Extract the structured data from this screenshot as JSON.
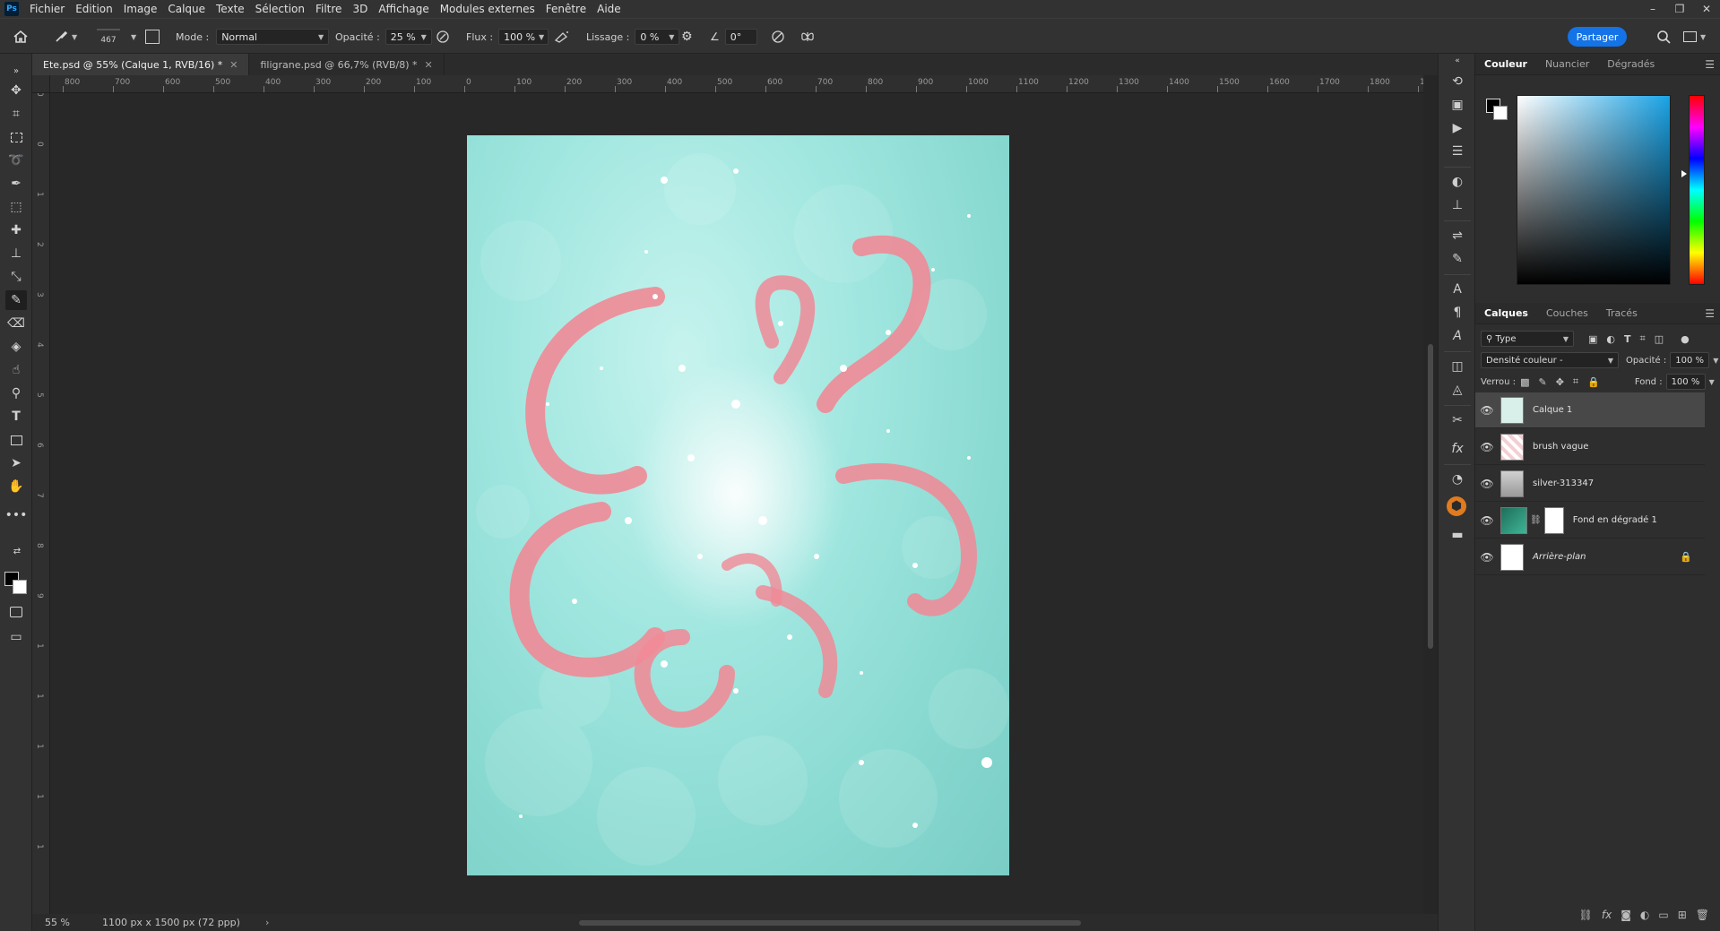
{
  "menu": {
    "logo": "Ps",
    "items": [
      "Fichier",
      "Edition",
      "Image",
      "Calque",
      "Texte",
      "Sélection",
      "Filtre",
      "3D",
      "Affichage",
      "Modules externes",
      "Fenêtre",
      "Aide"
    ]
  },
  "window_controls": {
    "minimize": "–",
    "restore": "❐",
    "close": "✕"
  },
  "options": {
    "brush_size": "467",
    "mode_label": "Mode :",
    "mode_value": "Normal",
    "opacity_label": "Opacité :",
    "opacity_value": "25 %",
    "flow_label": "Flux :",
    "flow_value": "100 %",
    "smoothing_label": "Lissage :",
    "smoothing_value": "0 %",
    "angle_value": "0°",
    "share_label": "Partager"
  },
  "tabs": [
    {
      "label": "Ete.psd @ 55% (Calque 1, RVB/16) *",
      "active": true
    },
    {
      "label": "filigrane.psd @ 66,7% (RVB/8) *",
      "active": false
    }
  ],
  "ruler_h_labels": [
    "800",
    "700",
    "600",
    "500",
    "400",
    "300",
    "200",
    "100",
    "0",
    "100",
    "200",
    "300",
    "400",
    "500",
    "600",
    "700",
    "800",
    "900",
    "1000",
    "1100",
    "1200",
    "1300",
    "1400",
    "1500",
    "1600",
    "1700",
    "1800",
    "1900"
  ],
  "ruler_v_labels": [
    "0",
    "0",
    "1",
    "2",
    "3",
    "4",
    "5",
    "6",
    "7",
    "8",
    "9",
    "1",
    "1",
    "1",
    "1",
    "1"
  ],
  "status": {
    "zoom": "55 %",
    "doc_size": "1100 px x 1500 px (72 ppp)",
    "arrow": "›"
  },
  "color_panel": {
    "tabs": [
      "Couleur",
      "Nuancier",
      "Dégradés"
    ],
    "active_tab": "Couleur",
    "foreground": "#000000",
    "background": "#ffffff"
  },
  "layers_panel": {
    "tabs": [
      "Calques",
      "Couches",
      "Tracés"
    ],
    "active_tab": "Calques",
    "filter_value": "Type",
    "blend_mode": "Densité couleur -",
    "opacity_label": "Opacité :",
    "opacity_value": "100 %",
    "lock_label": "Verrou :",
    "fill_label": "Fond :",
    "fill_value": "100 %",
    "layers": [
      {
        "name": "Calque 1",
        "selected": true,
        "thumb": "#d9efe9"
      },
      {
        "name": "brush vague",
        "selected": false,
        "thumb": "#f3cfd4"
      },
      {
        "name": "silver-313347",
        "selected": false,
        "thumb": "#bcbcbc"
      },
      {
        "name": "Fond en dégradé 1",
        "selected": false,
        "thumb": "#2a8f74",
        "mask": true
      },
      {
        "name": "Arrière-plan",
        "selected": false,
        "thumb": "#ffffff",
        "locked": true
      }
    ]
  },
  "colors": {
    "accent": "#1473e6",
    "art_pink": "#f08a96",
    "art_teal": "#9fe6df"
  }
}
